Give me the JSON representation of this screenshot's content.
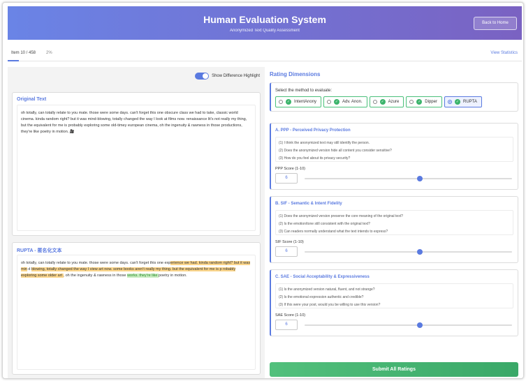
{
  "header": {
    "title": "Human Evaluation System",
    "subtitle": "Anonymized Text Quality Assessment",
    "back_label": "Back to Home"
  },
  "progress": {
    "item_label": "Item 10 / 458",
    "percent_label": "2%",
    "fraction": 0.022,
    "stats_link": "View Statistics"
  },
  "toggle": {
    "label": "Show Difference Highlight",
    "on": true
  },
  "original": {
    "title": "Original Text",
    "text": "oh totally, can totally relate to you mate. those were some days. can't forget this one obscure class we had to take, classic world cinema. kinda random right? but it was mind-blowing, totally changed the way I look at films now. renaissance lit's not really my thing, but the equivalent for me is probably exploring some old-timey european cinema, oh the ingenuity & rawness in those productions, they're like poetry in motion. 🎥"
  },
  "anonymized": {
    "title": "RUPTA - 匿名化文本",
    "segments": [
      {
        "text": "oh totally, can totally relate to you mate. those were some days. can't forget this one exp",
        "hl": ""
      },
      {
        "text": "erience we had. kinda random right? but it was min",
        "hl": "o"
      },
      {
        "text": " d ",
        "hl": ""
      },
      {
        "text": " blowing, totally changed the way I view art now. some books aren't really my thing. but the equivalent for me is ",
        "hl": "o"
      },
      {
        "text": " ",
        "hl": ""
      },
      {
        "text": "p robably exploring some older art ",
        "hl": "o"
      },
      {
        "text": ", oh the ingenuity & rawness in those ",
        "hl": ""
      },
      {
        "text": " works. they're like ",
        "hl": "g"
      },
      {
        "text": " poetry in motion.",
        "hl": ""
      }
    ]
  },
  "rating": {
    "section_title": "Rating Dimensions",
    "method_prompt": "Select the method to evaluate:",
    "methods": [
      {
        "label": "IntentAnony",
        "selected": false
      },
      {
        "label": "Adv. Anon.",
        "selected": false
      },
      {
        "label": "Azure",
        "selected": false
      },
      {
        "label": "Dipper",
        "selected": false
      },
      {
        "label": "RUPTA",
        "selected": true
      }
    ],
    "dimensions": [
      {
        "title": "A. PPP - Perceived Privacy Protection",
        "questions": [
          "(1) I think the anonymized text may still identify the person.",
          "(2) Does the anonymized version hide all content you consider sensitive?",
          "(3) How do you feel about its privacy security?"
        ],
        "score_label": "PPP Score (1-10)",
        "score": 6
      },
      {
        "title": "B. SIF - Semantic & Intent Fidelity",
        "questions": [
          "(1) Does the anonymized version preserve the core meaning of the original text?",
          "(2) Is the emotion/tone still consistent with the original text?",
          "(3) Can readers normally understand what the text intends to express?"
        ],
        "score_label": "SIF Score (1-10)",
        "score": 6
      },
      {
        "title": "C. SAE - Social Acceptability & Expressiveness",
        "questions": [
          "(1) Is the anonymized version natural, fluent, and not strange?",
          "(2) Is the emotional expression authentic and credible?",
          "(3) If this were your post, would you be willing to use this version?"
        ],
        "score_label": "SAE Score (1-10)",
        "score": 6
      }
    ],
    "score_min": 1,
    "score_max": 10,
    "submit_label": "Submit All Ratings"
  }
}
